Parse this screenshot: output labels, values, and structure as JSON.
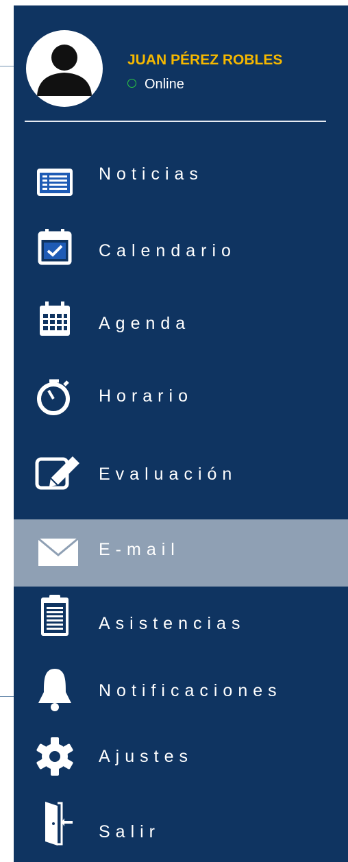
{
  "user": {
    "name": "JUAN PÉREZ ROBLES",
    "status": "Online"
  },
  "menu": [
    {
      "label": "Noticias",
      "icon": "news-icon",
      "active": false
    },
    {
      "label": "Calendario",
      "icon": "calendar-check-icon",
      "active": false
    },
    {
      "label": "Agenda",
      "icon": "calendar-grid-icon",
      "active": false
    },
    {
      "label": "Horario",
      "icon": "stopwatch-icon",
      "active": false
    },
    {
      "label": "Evaluación",
      "icon": "edit-icon",
      "active": false
    },
    {
      "label": "E-mail",
      "icon": "mail-icon",
      "active": true
    },
    {
      "label": "Asistencias",
      "icon": "clipboard-icon",
      "active": false
    },
    {
      "label": "Notificaciones",
      "icon": "bell-icon",
      "active": false
    },
    {
      "label": "Ajustes",
      "icon": "gear-icon",
      "active": false
    },
    {
      "label": "Salir",
      "icon": "exit-door-icon",
      "active": false
    }
  ],
  "colors": {
    "panel": "#0f3461",
    "active": "#8fa0b4",
    "name": "#f5b800",
    "online": "#2ecc40"
  }
}
